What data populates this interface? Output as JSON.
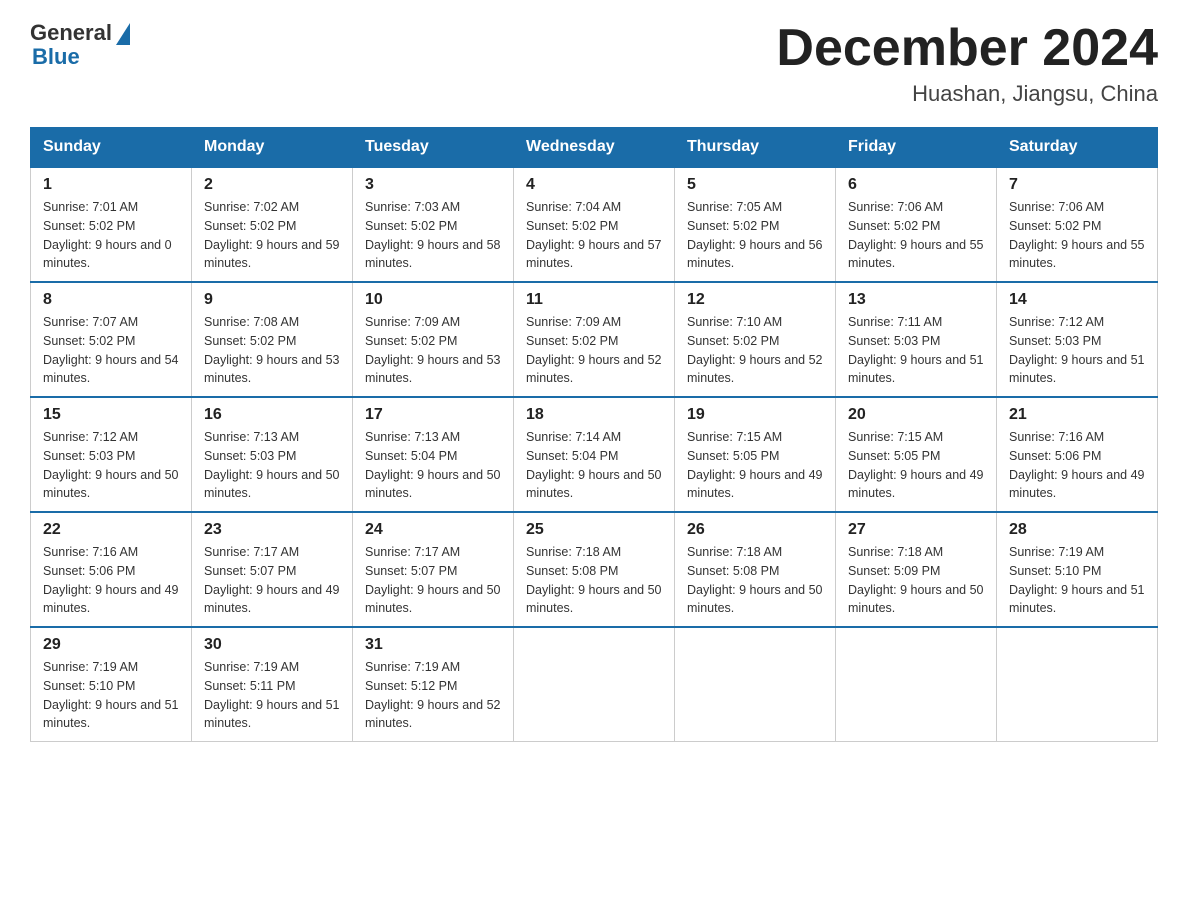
{
  "logo": {
    "general": "General",
    "blue": "Blue"
  },
  "title": {
    "month_year": "December 2024",
    "location": "Huashan, Jiangsu, China"
  },
  "headers": [
    "Sunday",
    "Monday",
    "Tuesday",
    "Wednesday",
    "Thursday",
    "Friday",
    "Saturday"
  ],
  "weeks": [
    [
      {
        "day": "1",
        "sunrise": "7:01 AM",
        "sunset": "5:02 PM",
        "daylight": "9 hours and 0 minutes."
      },
      {
        "day": "2",
        "sunrise": "7:02 AM",
        "sunset": "5:02 PM",
        "daylight": "9 hours and 59 minutes."
      },
      {
        "day": "3",
        "sunrise": "7:03 AM",
        "sunset": "5:02 PM",
        "daylight": "9 hours and 58 minutes."
      },
      {
        "day": "4",
        "sunrise": "7:04 AM",
        "sunset": "5:02 PM",
        "daylight": "9 hours and 57 minutes."
      },
      {
        "day": "5",
        "sunrise": "7:05 AM",
        "sunset": "5:02 PM",
        "daylight": "9 hours and 56 minutes."
      },
      {
        "day": "6",
        "sunrise": "7:06 AM",
        "sunset": "5:02 PM",
        "daylight": "9 hours and 55 minutes."
      },
      {
        "day": "7",
        "sunrise": "7:06 AM",
        "sunset": "5:02 PM",
        "daylight": "9 hours and 55 minutes."
      }
    ],
    [
      {
        "day": "8",
        "sunrise": "7:07 AM",
        "sunset": "5:02 PM",
        "daylight": "9 hours and 54 minutes."
      },
      {
        "day": "9",
        "sunrise": "7:08 AM",
        "sunset": "5:02 PM",
        "daylight": "9 hours and 53 minutes."
      },
      {
        "day": "10",
        "sunrise": "7:09 AM",
        "sunset": "5:02 PM",
        "daylight": "9 hours and 53 minutes."
      },
      {
        "day": "11",
        "sunrise": "7:09 AM",
        "sunset": "5:02 PM",
        "daylight": "9 hours and 52 minutes."
      },
      {
        "day": "12",
        "sunrise": "7:10 AM",
        "sunset": "5:02 PM",
        "daylight": "9 hours and 52 minutes."
      },
      {
        "day": "13",
        "sunrise": "7:11 AM",
        "sunset": "5:03 PM",
        "daylight": "9 hours and 51 minutes."
      },
      {
        "day": "14",
        "sunrise": "7:12 AM",
        "sunset": "5:03 PM",
        "daylight": "9 hours and 51 minutes."
      }
    ],
    [
      {
        "day": "15",
        "sunrise": "7:12 AM",
        "sunset": "5:03 PM",
        "daylight": "9 hours and 50 minutes."
      },
      {
        "day": "16",
        "sunrise": "7:13 AM",
        "sunset": "5:03 PM",
        "daylight": "9 hours and 50 minutes."
      },
      {
        "day": "17",
        "sunrise": "7:13 AM",
        "sunset": "5:04 PM",
        "daylight": "9 hours and 50 minutes."
      },
      {
        "day": "18",
        "sunrise": "7:14 AM",
        "sunset": "5:04 PM",
        "daylight": "9 hours and 50 minutes."
      },
      {
        "day": "19",
        "sunrise": "7:15 AM",
        "sunset": "5:05 PM",
        "daylight": "9 hours and 49 minutes."
      },
      {
        "day": "20",
        "sunrise": "7:15 AM",
        "sunset": "5:05 PM",
        "daylight": "9 hours and 49 minutes."
      },
      {
        "day": "21",
        "sunrise": "7:16 AM",
        "sunset": "5:06 PM",
        "daylight": "9 hours and 49 minutes."
      }
    ],
    [
      {
        "day": "22",
        "sunrise": "7:16 AM",
        "sunset": "5:06 PM",
        "daylight": "9 hours and 49 minutes."
      },
      {
        "day": "23",
        "sunrise": "7:17 AM",
        "sunset": "5:07 PM",
        "daylight": "9 hours and 49 minutes."
      },
      {
        "day": "24",
        "sunrise": "7:17 AM",
        "sunset": "5:07 PM",
        "daylight": "9 hours and 50 minutes."
      },
      {
        "day": "25",
        "sunrise": "7:18 AM",
        "sunset": "5:08 PM",
        "daylight": "9 hours and 50 minutes."
      },
      {
        "day": "26",
        "sunrise": "7:18 AM",
        "sunset": "5:08 PM",
        "daylight": "9 hours and 50 minutes."
      },
      {
        "day": "27",
        "sunrise": "7:18 AM",
        "sunset": "5:09 PM",
        "daylight": "9 hours and 50 minutes."
      },
      {
        "day": "28",
        "sunrise": "7:19 AM",
        "sunset": "5:10 PM",
        "daylight": "9 hours and 51 minutes."
      }
    ],
    [
      {
        "day": "29",
        "sunrise": "7:19 AM",
        "sunset": "5:10 PM",
        "daylight": "9 hours and 51 minutes."
      },
      {
        "day": "30",
        "sunrise": "7:19 AM",
        "sunset": "5:11 PM",
        "daylight": "9 hours and 51 minutes."
      },
      {
        "day": "31",
        "sunrise": "7:19 AM",
        "sunset": "5:12 PM",
        "daylight": "9 hours and 52 minutes."
      },
      null,
      null,
      null,
      null
    ]
  ]
}
